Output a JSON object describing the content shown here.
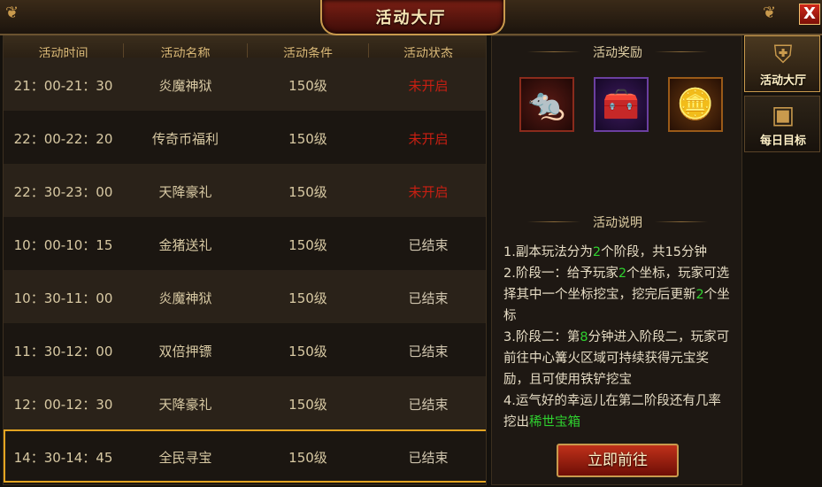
{
  "window": {
    "title": "活动大厅",
    "close_label": "X"
  },
  "table": {
    "headers": [
      "活动时间",
      "活动名称",
      "活动条件",
      "活动状态"
    ],
    "rows": [
      {
        "time": "21：00-21：30",
        "name": "炎魔神狱",
        "cond": "150级",
        "status": "未开启",
        "state": "open"
      },
      {
        "time": "22：00-22：20",
        "name": "传奇币福利",
        "cond": "150级",
        "status": "未开启",
        "state": "open"
      },
      {
        "time": "22：30-23：00",
        "name": "天降豪礼",
        "cond": "150级",
        "status": "未开启",
        "state": "open"
      },
      {
        "time": "10：00-10：15",
        "name": "金猪送礼",
        "cond": "150级",
        "status": "已结束",
        "state": "done"
      },
      {
        "time": "10：30-11：00",
        "name": "炎魔神狱",
        "cond": "150级",
        "status": "已结束",
        "state": "done"
      },
      {
        "time": "11：30-12：00",
        "name": "双倍押镖",
        "cond": "150级",
        "status": "已结束",
        "state": "done"
      },
      {
        "time": "12：00-12：30",
        "name": "天降豪礼",
        "cond": "150级",
        "status": "已结束",
        "state": "done"
      },
      {
        "time": "14：30-14：45",
        "name": "全民寻宝",
        "cond": "150级",
        "status": "已结束",
        "state": "done"
      }
    ],
    "selected_index": 7
  },
  "rewards": {
    "title": "活动奖励",
    "items": [
      {
        "icon": "rat-mount-icon"
      },
      {
        "icon": "treasure-chest-icon"
      },
      {
        "icon": "gold-ingot-icon"
      }
    ]
  },
  "description": {
    "title": "活动说明",
    "lines": [
      [
        {
          "t": "1.副本玩法分为"
        },
        {
          "t": "2",
          "hl": true
        },
        {
          "t": "个阶段，共15分钟"
        }
      ],
      [
        {
          "t": "2.阶段一：给予玩家"
        },
        {
          "t": "2",
          "hl": true
        },
        {
          "t": "个坐标，玩家可选择其中一个坐标挖宝，挖完后更新"
        },
        {
          "t": "2",
          "hl": true
        },
        {
          "t": "个坐标"
        }
      ],
      [
        {
          "t": "3.阶段二：第"
        },
        {
          "t": "8",
          "hl": true
        },
        {
          "t": "分钟进入阶段二，玩家可前往中心篝火区域可持续获得元宝奖励，且可使用铁铲挖宝"
        }
      ],
      [
        {
          "t": "4.运气好的幸运儿在第二阶段还有几率挖出"
        },
        {
          "t": "稀世宝箱",
          "hl": true
        }
      ]
    ]
  },
  "go_button": "立即前往",
  "side_tabs": [
    {
      "label": "活动大厅",
      "icon": "armor-icon",
      "active": true
    },
    {
      "label": "每日目标",
      "icon": "chest-icon",
      "active": false
    }
  ],
  "colors": {
    "status_open": "#c91f12",
    "highlight_green": "#2fd12f",
    "selected_border": "#e3a421"
  }
}
